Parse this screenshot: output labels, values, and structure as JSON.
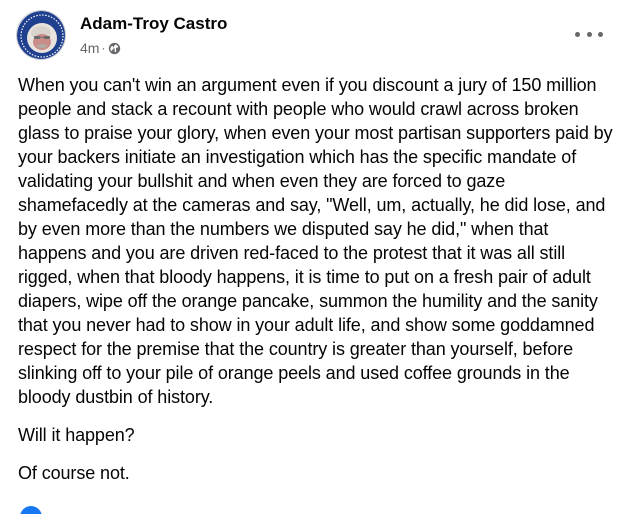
{
  "post": {
    "author": "Adam-Troy Castro",
    "time": "4m",
    "separator": "·",
    "audience_icon": "globe-icon",
    "menu_icon": "more-options-icon",
    "paragraphs": [
      "When you can't win an argument even if you discount a jury of 150 million people and stack a recount with people who would crawl across broken glass to praise your glory, when even your most partisan supporters paid by your backers initiate an investigation which has the specific mandate of validating your bullshit and when even they are forced to gaze shamefacedly at the cameras and say, \"Well, um, actually, he did lose, and by even more than the numbers we disputed say he did,\" when that happens and you are driven red-faced to the protest that it was all still rigged, when that bloody happens, it is time to put on a fresh pair of adult diapers, wipe off the orange pancake, summon the humility and the sanity that you never had to show in your adult life, and show some goddamned respect for the premise that the country is greater than yourself, before slinking off to your pile of orange peels and used coffee grounds in the bloody dustbin of history.",
      "Will it happen?",
      "Of course not."
    ]
  },
  "colors": {
    "text": "#050505",
    "secondary": "#65676b",
    "accent": "#1877f2",
    "background": "#ffffff"
  }
}
